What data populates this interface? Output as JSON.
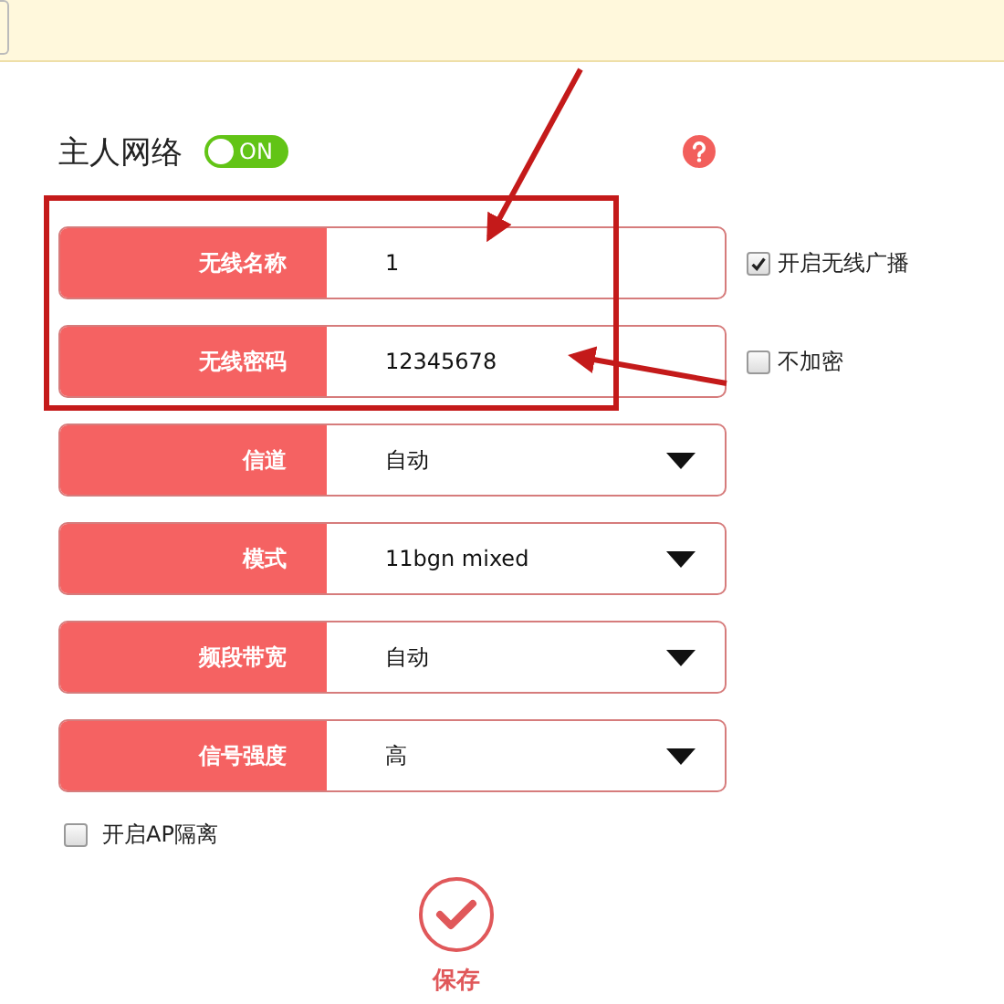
{
  "section": {
    "title": "主人网络",
    "toggle": {
      "label": "ON",
      "on": true
    }
  },
  "fields": [
    {
      "label": "无线名称",
      "kind": "text",
      "value": "1",
      "option": {
        "label": "开启无线广播",
        "checked": true
      }
    },
    {
      "label": "无线密码",
      "kind": "text",
      "value": "12345678",
      "option": {
        "label": "不加密",
        "checked": false
      }
    },
    {
      "label": "信道",
      "kind": "select",
      "value": "自动"
    },
    {
      "label": "模式",
      "kind": "select",
      "value": "11bgn mixed"
    },
    {
      "label": "频段带宽",
      "kind": "select",
      "value": "自动"
    },
    {
      "label": "信号强度",
      "kind": "select",
      "value": "高"
    }
  ],
  "ap_isolation": {
    "label": "开启AP隔离",
    "checked": false
  },
  "save": {
    "label": "保存"
  }
}
